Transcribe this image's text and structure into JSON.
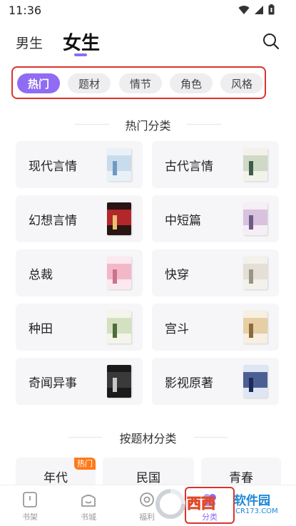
{
  "status": {
    "time": "11:36"
  },
  "gender_tabs": {
    "male": "男生",
    "female": "女生"
  },
  "chips": [
    "热门",
    "题材",
    "情节",
    "角色",
    "风格"
  ],
  "hot_section": {
    "title": "热门分类",
    "cards": [
      {
        "label": "现代言情",
        "cover": [
          "#e9f1f8",
          "#c9dcec",
          "#6f9ac3"
        ]
      },
      {
        "label": "古代言情",
        "cover": [
          "#f3f2ea",
          "#cfd9c6",
          "#3f5b4a"
        ]
      },
      {
        "label": "幻想言情",
        "cover": [
          "#2a1414",
          "#b3262a",
          "#e8c070"
        ]
      },
      {
        "label": "中短篇",
        "cover": [
          "#f5eef4",
          "#d9c2dd",
          "#6e5a86"
        ]
      },
      {
        "label": "总裁",
        "cover": [
          "#fbe9ef",
          "#f2b8c9",
          "#c9748c"
        ]
      },
      {
        "label": "快穿",
        "cover": [
          "#f3f1ec",
          "#e4e0d6",
          "#9b9484"
        ]
      },
      {
        "label": "种田",
        "cover": [
          "#f4f4ea",
          "#d4e1c0",
          "#4f6d3a"
        ]
      },
      {
        "label": "宫斗",
        "cover": [
          "#f6efe2",
          "#e7cfa5",
          "#8c6b3b"
        ]
      },
      {
        "label": "奇闻异事",
        "cover": [
          "#1a1a1a",
          "#3a3a3a",
          "#c8c8c8"
        ]
      },
      {
        "label": "影视原著",
        "cover": [
          "#dfe6f3",
          "#4c5f95",
          "#1e2a55"
        ]
      }
    ]
  },
  "theme_section": {
    "title": "按题材分类",
    "cards": [
      {
        "label": "年代",
        "badge": "热门"
      },
      {
        "label": "民国",
        "badge": ""
      },
      {
        "label": "青春",
        "badge": ""
      }
    ]
  },
  "bottom_nav": [
    {
      "label": "书架",
      "icon": "bookshelf-icon"
    },
    {
      "label": "书城",
      "icon": "bookstore-icon"
    },
    {
      "label": "福利",
      "icon": "gift-icon"
    },
    {
      "label": "分类",
      "icon": "category-icon"
    }
  ],
  "watermark": {
    "brand": "西西",
    "site": "软件园",
    "domain": "CR173.COM"
  },
  "colors": {
    "accent": "#8f6cf3",
    "highlight_border": "#d9342b",
    "hot_badge": "#ff7a1a"
  }
}
